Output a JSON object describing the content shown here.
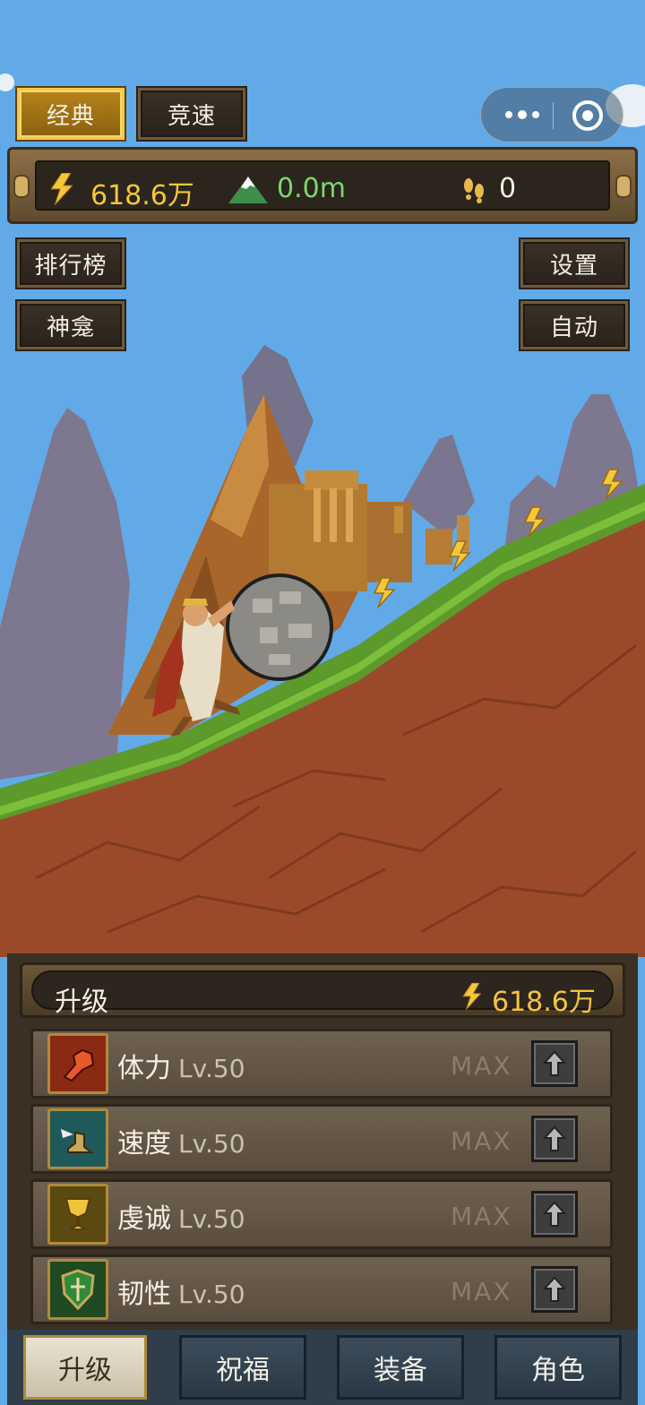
{
  "modes": {
    "classic": "经典",
    "race": "竞速"
  },
  "stats": {
    "energy": "618.6万",
    "height": "0.0m",
    "steps": "0"
  },
  "side_buttons": {
    "leaderboard": "排行榜",
    "shrine": "神龛",
    "settings": "设置",
    "auto": "自动"
  },
  "upgrade_panel": {
    "title": "升级",
    "energy": "618.6万",
    "rows": [
      {
        "name": "体力",
        "level": "Lv.50",
        "status": "MAX",
        "icon": "fist-icon"
      },
      {
        "name": "速度",
        "level": "Lv.50",
        "status": "MAX",
        "icon": "winged-boot-icon"
      },
      {
        "name": "虔诚",
        "level": "Lv.50",
        "status": "MAX",
        "icon": "chalice-icon"
      },
      {
        "name": "韧性",
        "level": "Lv.50",
        "status": "MAX",
        "icon": "shield-icon"
      }
    ]
  },
  "tabs": [
    "升级",
    "祝福",
    "装备",
    "角色"
  ],
  "colors": {
    "sky": "#62a9e8",
    "energy_text": "#f5c63a",
    "height_text": "#7bd86a",
    "gold": "#f3c94a",
    "dirt": "#9a4a2b",
    "grass": "#5c9a2c"
  }
}
